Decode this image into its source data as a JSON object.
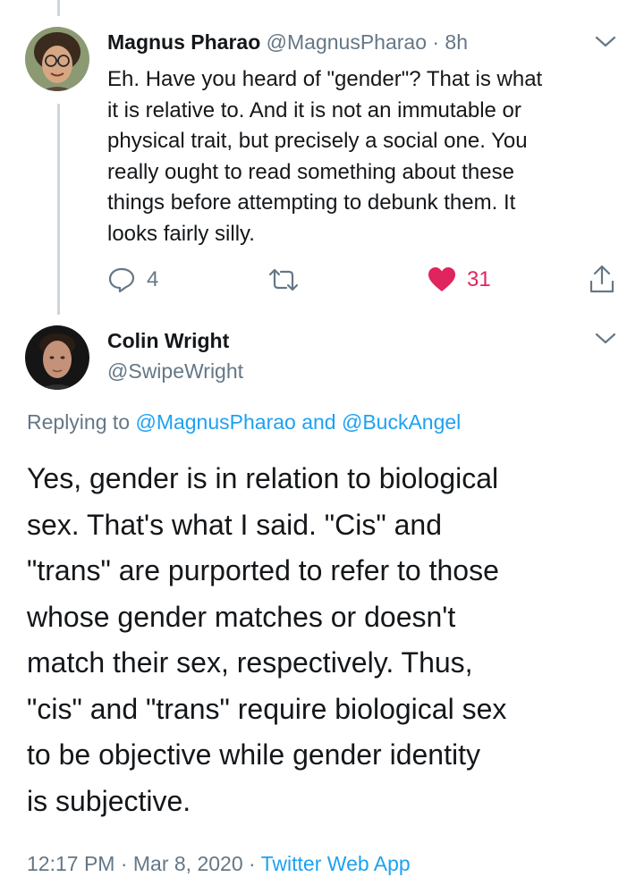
{
  "tweet1": {
    "name": "Magnus Pharao",
    "handle_time": "@MagnusPharao · 8h",
    "text_lines": [
      "Eh. Have you heard of \"gender\"? That is what",
      "it is relative to. And it is not an immutable or",
      "physical trait, but precisely a social one. You",
      "really ought to read something about these",
      "things before attempting to debunk them. It",
      "looks fairly silly."
    ],
    "reply_count": "4",
    "like_count": "31"
  },
  "tweet2": {
    "name": "Colin Wright",
    "handle": "@SwipeWright",
    "replying_prefix": "Replying to ",
    "replying_user1": "@MagnusPharao",
    "replying_and": " and ",
    "replying_user2": "@BuckAngel",
    "text_lines": [
      "Yes, gender is in relation to biological",
      "sex. That's what I said. \"Cis\" and",
      "\"trans\" are purported to refer to those",
      "whose gender matches or doesn't",
      "match their sex, respectively. Thus,",
      "\"cis\" and \"trans\" require biological sex",
      "to be objective while gender identity",
      "is subjective."
    ],
    "timestamp": "12:17 PM · Mar 8, 2020 · ",
    "source": "Twitter Web App"
  },
  "colors": {
    "link": "#1da1f2",
    "like": "#e0245e",
    "muted": "#657786",
    "thread_line": "#cdd5dc"
  },
  "icons": [
    "reply-icon",
    "retweet-icon",
    "like-icon",
    "share-icon",
    "chevron-down-icon"
  ]
}
